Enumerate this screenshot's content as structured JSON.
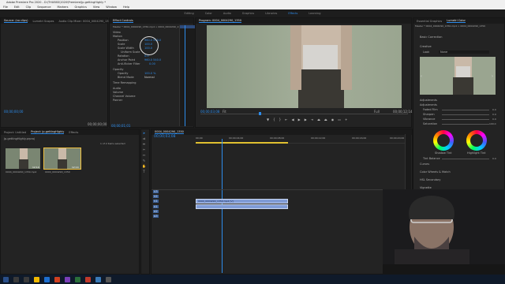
{
  "app": {
    "title": "Adobe Premiere Pro 2020 - D:\\THUBSS\\2020\\Premiere\\Jp.gettingHighly *",
    "menu": [
      "File",
      "Edit",
      "Clip",
      "Sequence",
      "Markers",
      "Graphics",
      "View",
      "Window",
      "Help"
    ]
  },
  "workspaces": [
    "Editing",
    "Color",
    "Audio",
    "Graphics",
    "Libraries",
    "Effects",
    "Learning"
  ],
  "active_workspace": "Effects",
  "source_panel": {
    "tabs": [
      "Source: (no clips)",
      "Lumetri Scopes",
      "Audio Clip Mixer: 0004_0004290_1350"
    ],
    "timecode_left": "00;00;00;00",
    "timecode_right": "00;00;00;00"
  },
  "effect_controls": {
    "tab": "Effect Controls",
    "header": "Master * 0004_0004290_1350.mp4 > 0004_0004290_1350",
    "sections": {
      "video": "Video",
      "motion": "Motion",
      "position": "Position",
      "scale": "Scale",
      "scale_width": "Scale Width",
      "uniform": "Uniform Scale",
      "rotation": "Rotation",
      "anchor": "Anchor Point",
      "anti_flicker": "Anti-flicker Filter",
      "opacity": "Opacity",
      "opacity_label": "Opacity",
      "blend": "Blend Mode",
      "time_remap": "Time Remapping",
      "audio": "Audio",
      "volume": "Volume",
      "channel_volume": "Channel Volume",
      "panner": "Panner"
    },
    "values": {
      "position": "960.0   540.0",
      "scale": "100.0",
      "scale_width": "100.0",
      "rotation": "0.0",
      "anchor": "960.0   540.0",
      "anti_flicker": "0.00",
      "opacity": "100.0 %",
      "blend": "Normal"
    },
    "timecode": "00;00;01;01"
  },
  "program_monitor": {
    "tab": "Program: 0004_0004290_1350",
    "timecode_left": "00;00;03;08",
    "fit": "Fit",
    "quality": "Full",
    "timecode_right": "00;00;12;14"
  },
  "lumetri": {
    "tabs": [
      "Essential Graphics",
      "Lumetri Color"
    ],
    "header": "Master * 0004_0004290_1350.mp4 > 0004_0004290_1350",
    "sections": [
      "Basic Correction",
      "Creative",
      "Curves",
      "Color Wheels & Match",
      "HSL Secondary",
      "Vignette"
    ],
    "look_label": "Look",
    "look_value": "None",
    "adjust": "Adjustments",
    "rows": [
      "Faded Film",
      "Sharpen",
      "Vibrance",
      "Saturation"
    ],
    "wheels": [
      "Shadow Tint",
      "Highlight Tint"
    ],
    "tint_balance": "Tint Balance",
    "values": [
      "0.0",
      "0.0",
      "0.0",
      "100.0",
      "0.0"
    ]
  },
  "project_panel": {
    "tabs": [
      "Project: Untitled",
      "Project: Jp.gettingHighly",
      "Effects"
    ],
    "path": "Jp.gettingHighly.prproj",
    "count": "1 of 2 items selected",
    "items": [
      {
        "name": "0004_0004290_1350.mp4",
        "duration": "12:14"
      },
      {
        "name": "0004_0004290_1350",
        "duration": "12:14"
      }
    ]
  },
  "timeline": {
    "tab": "0004_0004290_1350",
    "timecode": "00;00;03;08",
    "ruler": [
      "00;00",
      "00;00;04;00",
      "00;00;08;00",
      "00;00;12;00",
      "00;00;16;00",
      "00;00;20;00"
    ],
    "tracks": [
      "V3",
      "V2",
      "V1",
      "A1",
      "A2",
      "A3"
    ],
    "video_clip": "0004_0004290_1350.mp4 [V]",
    "audio_clip": ""
  },
  "colors": {
    "accent": "#2d8ceb",
    "clip_video": "#7f9bd6",
    "clip_audio": "#7f9bd6",
    "panel_bg": "#232323"
  }
}
